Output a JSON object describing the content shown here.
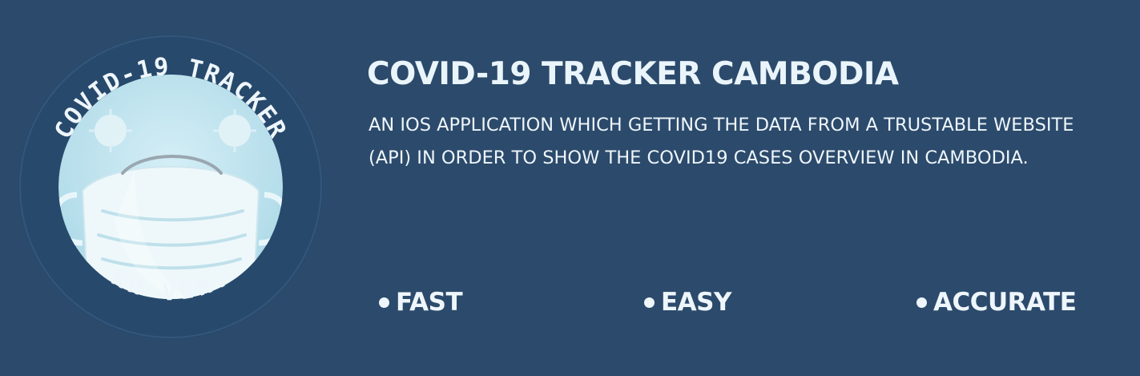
{
  "logo": {
    "top_text": "COVID-19 TRACKER",
    "bottom_text": "KH VER.",
    "icon": "face-mask-icon"
  },
  "title": "COVID-19 TRACKER CAMBODIA",
  "description": "AN IOS APPLICATION WHICH GETTING THE DATA FROM A TRUSTABLE WEBSITE (API) IN ORDER TO SHOW THE COVID19 CASES OVERVIEW IN CAMBODIA.",
  "features": [
    "FAST",
    "EASY",
    "ACCURATE"
  ],
  "colors": {
    "background": "#2c4a6b",
    "badge_ring": "#27496c",
    "badge_inner": "#bfe3ee",
    "text": "#eef6fb"
  }
}
